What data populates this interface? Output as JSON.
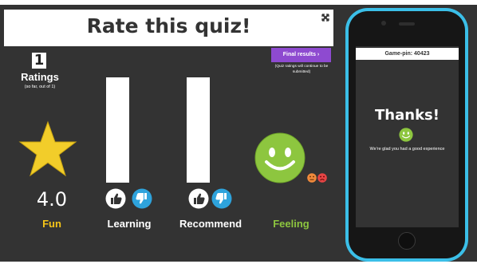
{
  "quiz": {
    "title": "Rate this quiz!",
    "ratings_count": "1",
    "ratings_label": "Ratings",
    "ratings_sub": "(so far, out of 1)",
    "final_results_label": "Final results ›",
    "final_results_note": "(Quiz ratings will continue to be submitted)",
    "fun": {
      "score": "4.0",
      "label": "Fun",
      "icon": "star-icon"
    },
    "learning": {
      "label": "Learning",
      "up_icon": "thumbs-up-icon",
      "down_icon": "thumbs-down-icon"
    },
    "recommend": {
      "label": "Recommend",
      "up_icon": "thumbs-up-icon",
      "down_icon": "thumbs-down-icon"
    },
    "feeling": {
      "label": "Feeling",
      "icon": "smiley-face-icon"
    }
  },
  "phone": {
    "game_pin": "Game-pin: 40423",
    "thanks": "Thanks!",
    "message": "We're glad you had a good experience"
  },
  "colors": {
    "panel": "#333333",
    "accent_purple": "#8e4ad0",
    "star": "#f2cd2a",
    "label_yellow": "#f5c518",
    "feeling_green": "#8dc63f",
    "phone_frame": "#3bbfe8",
    "thumb_down_blue": "#2ea3dc",
    "sad_red": "#e64545"
  }
}
